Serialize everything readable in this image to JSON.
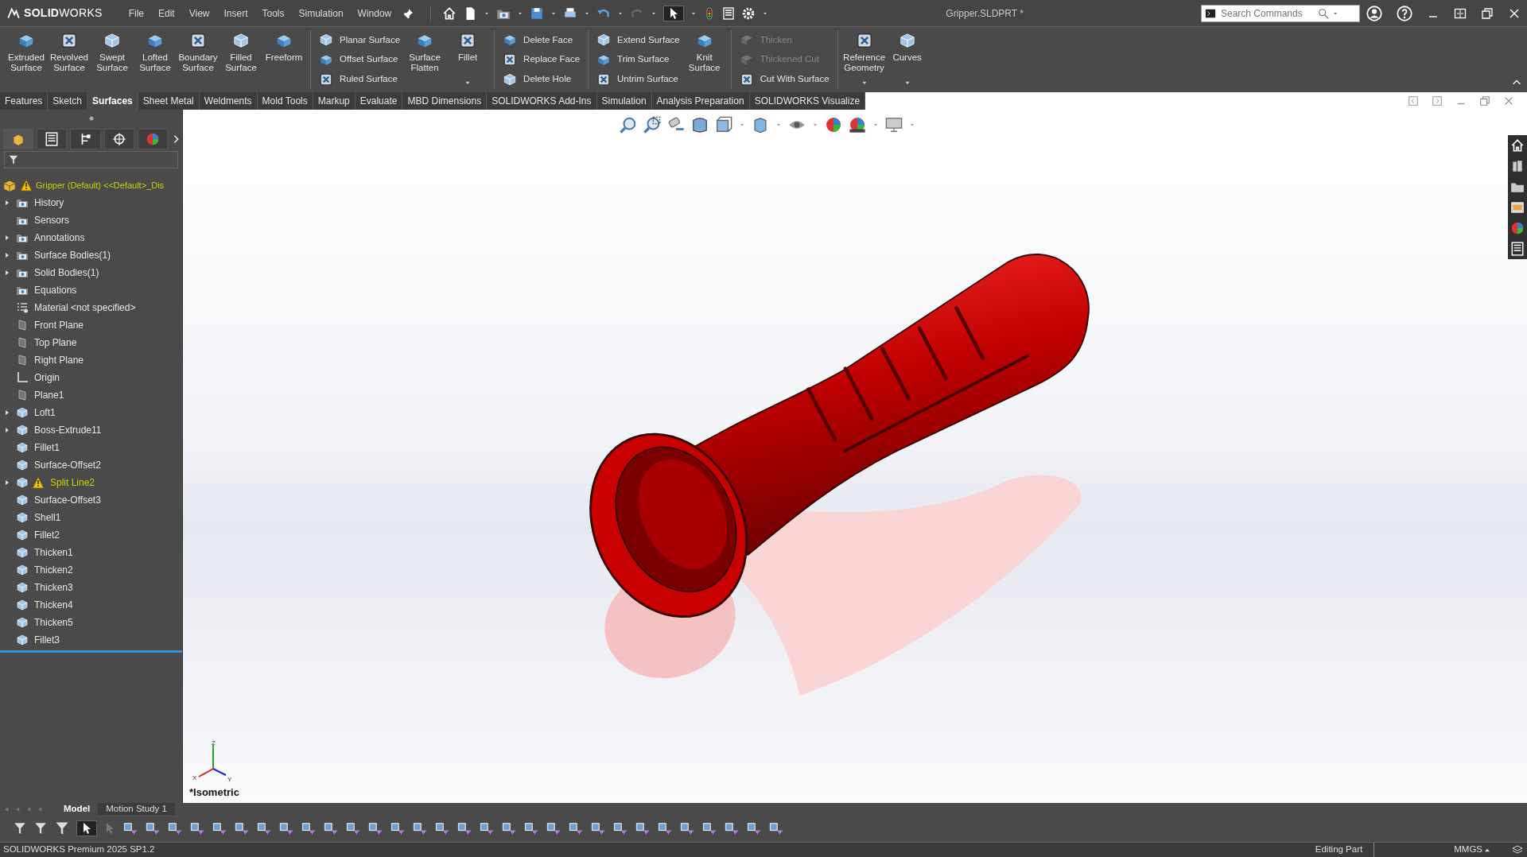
{
  "title_bar": {
    "app_name": "**SOLID**WORKS",
    "menu": [
      "File",
      "Edit",
      "View",
      "Insert",
      "Tools",
      "Simulation",
      "Window"
    ],
    "document_title": "Gripper.SLDPRT *",
    "search": {
      "placeholder": "Search Commands"
    }
  },
  "ribbon": [
    {
      "kind": "large",
      "label": "Extruded Surface"
    },
    {
      "kind": "large",
      "label": "Revolved Surface"
    },
    {
      "kind": "large",
      "label": "Swept Surface"
    },
    {
      "kind": "large",
      "label": "Lofted Surface"
    },
    {
      "kind": "large",
      "label": "Boundary Surface"
    },
    {
      "kind": "large",
      "label": "Filled Surface"
    },
    {
      "kind": "large",
      "label": "Freeform"
    },
    {
      "kind": "separator"
    },
    {
      "kind": "stack",
      "items": [
        {
          "label": "Planar Surface",
          "disabled": false
        },
        {
          "label": "Offset Surface",
          "disabled": false
        },
        {
          "label": "Ruled Surface",
          "disabled": false
        }
      ]
    },
    {
      "kind": "large",
      "label": "Surface Flatten"
    },
    {
      "kind": "large",
      "label": "Fillet",
      "dropdown": true
    },
    {
      "kind": "separator"
    },
    {
      "kind": "stack",
      "items": [
        {
          "label": "Delete Face",
          "disabled": false
        },
        {
          "label": "Replace Face",
          "disabled": false
        },
        {
          "label": "Delete Hole",
          "disabled": false
        }
      ]
    },
    {
      "kind": "separator"
    },
    {
      "kind": "stack",
      "items": [
        {
          "label": "Extend Surface",
          "disabled": false
        },
        {
          "label": "Trim Surface",
          "disabled": false
        },
        {
          "label": "Untrim Surface",
          "disabled": false
        }
      ]
    },
    {
      "kind": "large",
      "label": "Knit Surface"
    },
    {
      "kind": "separator"
    },
    {
      "kind": "stack",
      "items": [
        {
          "label": "Thicken",
          "disabled": true
        },
        {
          "label": "Thickened Cut",
          "disabled": true
        },
        {
          "label": "Cut With Surface",
          "disabled": false
        }
      ]
    },
    {
      "kind": "separator"
    },
    {
      "kind": "large",
      "label": "Reference Geometry",
      "dropdown": true
    },
    {
      "kind": "large",
      "label": "Curves",
      "dropdown": true
    }
  ],
  "command_tabs": [
    {
      "label": "Features",
      "selected": false
    },
    {
      "label": "Sketch",
      "selected": false
    },
    {
      "label": "Surfaces",
      "selected": true
    },
    {
      "label": "Sheet Metal",
      "selected": false
    },
    {
      "label": "Weldments",
      "selected": false
    },
    {
      "label": "Mold Tools",
      "selected": false
    },
    {
      "label": "Markup",
      "selected": false
    },
    {
      "label": "Evaluate",
      "selected": false
    },
    {
      "label": "MBD Dimensions",
      "selected": false
    },
    {
      "label": "SOLIDWORKS Add-Ins",
      "selected": false
    },
    {
      "label": "Simulation",
      "selected": false
    },
    {
      "label": "Analysis Preparation",
      "selected": false
    },
    {
      "label": "SOLIDWORKS Visualize",
      "selected": false
    }
  ],
  "feature_tree": {
    "tabs": [
      {
        "selected": true
      },
      {
        "selected": false
      },
      {
        "selected": false
      },
      {
        "selected": false
      },
      {
        "selected": false
      }
    ],
    "root": {
      "label": "Gripper (Default) <<Default>_Dis",
      "warning": true
    },
    "items": [
      {
        "label": "History",
        "kind": "folder",
        "expanded": false,
        "warning": false
      },
      {
        "label": "Sensors",
        "kind": "folder",
        "warning": false
      },
      {
        "label": "Annotations",
        "kind": "folder",
        "expanded": false,
        "warning": false
      },
      {
        "label": "Surface Bodies(1)",
        "kind": "folder",
        "expanded": false,
        "warning": false
      },
      {
        "label": "Solid Bodies(1)",
        "kind": "folder",
        "expanded": false,
        "warning": false
      },
      {
        "label": "Equations",
        "kind": "folder",
        "warning": false
      },
      {
        "label": "Material <not specified>",
        "kind": "material",
        "warning": false
      },
      {
        "label": "Front Plane",
        "kind": "plane",
        "warning": false
      },
      {
        "label": "Top Plane",
        "kind": "plane",
        "warning": false
      },
      {
        "label": "Right Plane",
        "kind": "plane",
        "warning": false
      },
      {
        "label": "Origin",
        "kind": "origin",
        "warning": false
      },
      {
        "label": "Plane1",
        "kind": "plane",
        "warning": false
      },
      {
        "label": "Loft1",
        "kind": "feature",
        "expanded": false,
        "warning": false
      },
      {
        "label": "Boss-Extrude11",
        "kind": "feature",
        "expanded": false,
        "warning": false
      },
      {
        "label": "Fillet1",
        "kind": "feature",
        "warning": false
      },
      {
        "label": "Surface-Offset2",
        "kind": "feature",
        "warning": false
      },
      {
        "label": "Split Line2",
        "kind": "feature",
        "expanded": false,
        "warning": true
      },
      {
        "label": "Surface-Offset3",
        "kind": "feature",
        "warning": false
      },
      {
        "label": "Shell1",
        "kind": "feature",
        "warning": false
      },
      {
        "label": "Fillet2",
        "kind": "feature",
        "warning": false
      },
      {
        "label": "Thicken1",
        "kind": "feature",
        "warning": false
      },
      {
        "label": "Thicken2",
        "kind": "feature",
        "warning": false
      },
      {
        "label": "Thicken3",
        "kind": "feature",
        "warning": false
      },
      {
        "label": "Thicken4",
        "kind": "feature",
        "warning": false
      },
      {
        "label": "Thicken5",
        "kind": "feature",
        "warning": false
      },
      {
        "label": "Fillet3",
        "kind": "feature",
        "warning": false
      }
    ]
  },
  "viewport": {
    "view_label": "*Isometric",
    "triad_axes": {
      "x": "X",
      "y": "Y",
      "z": "Z"
    }
  },
  "bottom_tabs": [
    {
      "label": "Model",
      "selected": true
    },
    {
      "label": "Motion Study 1",
      "selected": false
    }
  ],
  "status_bar": {
    "product": "SOLIDWORKS Premium 2025 SP1.2",
    "mode": "Editing Part",
    "units": "MMGS"
  }
}
